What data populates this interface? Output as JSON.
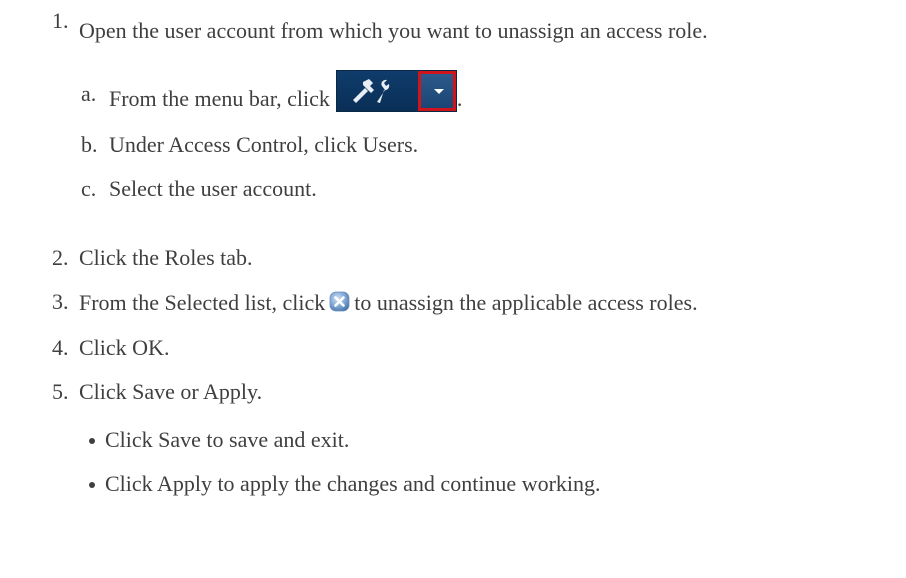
{
  "steps": [
    {
      "number": "1.",
      "text": "Open the user account from which you want to unassign an access role.",
      "substeps": [
        {
          "marker": "a.",
          "text_before": "From the menu bar, click",
          "text_after": ".",
          "icon": "tools-dropdown-icon"
        },
        {
          "marker": "b.",
          "text": "Under Access Control, click Users."
        },
        {
          "marker": "c.",
          "text": "Select the user account."
        }
      ]
    },
    {
      "number": "2.",
      "text": "Click the Roles tab."
    },
    {
      "number": "3.",
      "text_before": "From the Selected list, click",
      "icon": "remove-x-icon",
      "text_after": "to unassign the applicable access roles."
    },
    {
      "number": "4.",
      "text": "Click OK."
    },
    {
      "number": "5.",
      "text": "Click Save or Apply.",
      "bullets": [
        {
          "text": "Click Save to save and exit."
        },
        {
          "text": "Click Apply to apply the changes and continue working."
        }
      ]
    }
  ]
}
